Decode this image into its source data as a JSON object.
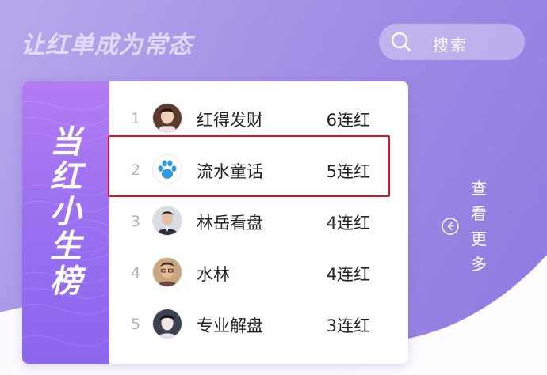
{
  "header": {
    "slogan": "让红单成为常态",
    "search_label": "搜索",
    "search_icon": "search-icon"
  },
  "banner": {
    "title_chars": [
      "当",
      "红",
      "小",
      "生",
      "榜"
    ]
  },
  "leaderboard": {
    "rows": [
      {
        "rank": "1",
        "name": "红得发财",
        "streak": "6连红",
        "avatar": "photo-woman"
      },
      {
        "rank": "2",
        "name": "流水童话",
        "streak": "5连红",
        "avatar": "paw-print",
        "highlighted": true
      },
      {
        "rank": "3",
        "name": "林岳看盘",
        "streak": "4连红",
        "avatar": "photo-man-suit"
      },
      {
        "rank": "4",
        "name": "水林",
        "streak": "4连红",
        "avatar": "photo-man-glasses"
      },
      {
        "rank": "5",
        "name": "专业解盘",
        "streak": "3连红",
        "avatar": "photo-woman-2"
      }
    ]
  },
  "view_more": {
    "chars": [
      "查",
      "看",
      "更",
      "多"
    ],
    "icon": "arrow-left-circle-icon"
  },
  "colors": {
    "highlight_border": "#e0141c",
    "banner_top": "#b27cf2",
    "banner_bottom": "#8c66ee",
    "paw_blue": "#2f9be6"
  }
}
